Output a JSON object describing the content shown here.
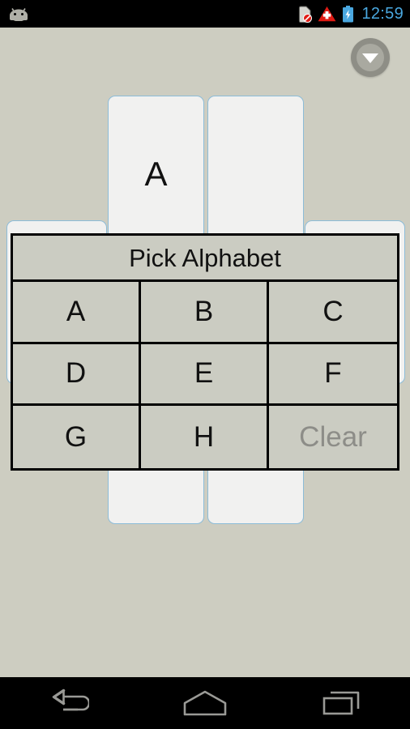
{
  "status_bar": {
    "clock": "12:59",
    "clock_color": "#4aa8e0",
    "icons": [
      {
        "name": "sim-card-missing-icon",
        "glyph": "sim-off"
      },
      {
        "name": "warning-triangle-icon",
        "glyph": "warning",
        "color": "#e01b14"
      },
      {
        "name": "battery-charging-icon",
        "glyph": "battery-charging",
        "color": "#4aa8e0"
      }
    ],
    "left_icon": {
      "name": "android-robot-icon",
      "color": "#b0b0a8"
    }
  },
  "collapse_button": {
    "label": "",
    "icon": "chevron-down-icon",
    "ring_color": "#8e8e86",
    "inner_color": "#a9a9a0"
  },
  "background": {
    "page_color": "#cdcdc1",
    "card_fill": "#f1f1f0",
    "card_border": "#8cbcd8"
  },
  "cards": {
    "front_left": {
      "letter": "A"
    },
    "front_right": {
      "letter": ""
    },
    "wide_left": {
      "letter": ""
    },
    "wide_right": {
      "letter": ""
    }
  },
  "dialog": {
    "title": "Pick Alphabet",
    "border_color": "#000000",
    "background_color": "#cbccc2",
    "disabled_text_color": "#8d8d88",
    "cells": [
      {
        "label": "A",
        "disabled": false
      },
      {
        "label": "B",
        "disabled": false
      },
      {
        "label": "C",
        "disabled": false
      },
      {
        "label": "D",
        "disabled": false
      },
      {
        "label": "E",
        "disabled": false
      },
      {
        "label": "F",
        "disabled": false
      },
      {
        "label": "G",
        "disabled": false
      },
      {
        "label": "H",
        "disabled": false
      },
      {
        "label": "Clear",
        "disabled": true
      }
    ]
  },
  "nav_bar": {
    "buttons": [
      {
        "name": "back-button",
        "icon": "back-arrow-icon"
      },
      {
        "name": "home-button",
        "icon": "home-icon"
      },
      {
        "name": "recents-button",
        "icon": "recents-icon"
      }
    ],
    "icon_color": "#9a9a96",
    "background_color": "#000000"
  }
}
